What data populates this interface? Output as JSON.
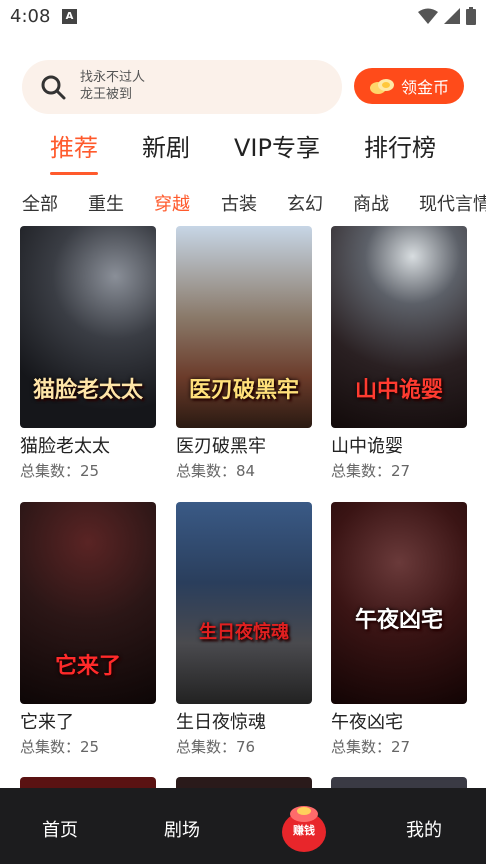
{
  "status_bar": {
    "time": "4:08",
    "notification_badge": "A"
  },
  "search": {
    "hint_line1": "找永不过人",
    "hint_line2": "龙王被到"
  },
  "gold_button": {
    "label": "领金币"
  },
  "main_tabs": [
    {
      "label": "推荐",
      "active": true
    },
    {
      "label": "新剧",
      "active": false
    },
    {
      "label": "VIP专享",
      "active": false
    },
    {
      "label": "排行榜",
      "active": false
    }
  ],
  "categories": [
    {
      "label": "全部",
      "active": false
    },
    {
      "label": "重生",
      "active": false
    },
    {
      "label": "穿越",
      "active": true
    },
    {
      "label": "古装",
      "active": false
    },
    {
      "label": "玄幻",
      "active": false
    },
    {
      "label": "商战",
      "active": false
    },
    {
      "label": "现代言情",
      "active": false
    }
  ],
  "episodes_label": "总集数：",
  "dramas": [
    {
      "title": "猫脸老太太",
      "poster_text": "猫脸老太太",
      "episodes": "25"
    },
    {
      "title": "医刃破黑牢",
      "poster_text": "医刃破黑牢",
      "episodes": "84"
    },
    {
      "title": "山中诡婴",
      "poster_text": "山中诡婴",
      "episodes": "27"
    },
    {
      "title": "它来了",
      "poster_text": "它来了",
      "episodes": "25"
    },
    {
      "title": "生日夜惊魂",
      "poster_text": "生日夜惊魂",
      "episodes": "76"
    },
    {
      "title": "午夜凶宅",
      "poster_text": "午夜凶宅",
      "episodes": "27"
    }
  ],
  "bottom_nav": {
    "home": "首页",
    "theater": "剧场",
    "earn": "赚钱",
    "mine": "我的"
  },
  "colors": {
    "accent": "#ff5a2c",
    "gold_button": "#ff4b1a",
    "search_bg": "#fbf1ea",
    "nav_bg": "#1c1c1e"
  }
}
